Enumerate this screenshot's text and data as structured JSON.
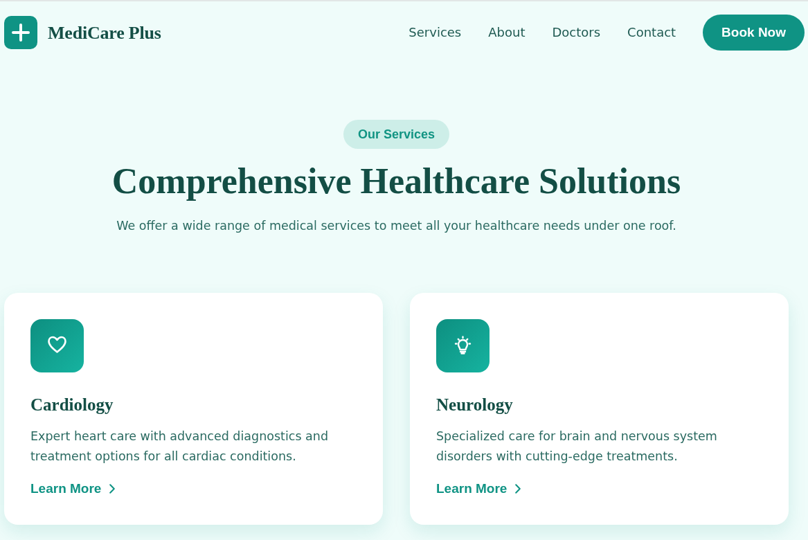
{
  "brand": {
    "name": "MediCare Plus"
  },
  "nav": {
    "links": [
      {
        "label": "Services"
      },
      {
        "label": "About"
      },
      {
        "label": "Doctors"
      },
      {
        "label": "Contact"
      }
    ],
    "cta": "Book Now"
  },
  "hero": {
    "badge": "Our Services",
    "title": "Comprehensive Healthcare Solutions",
    "subtitle": "We offer a wide range of medical services to meet all your healthcare needs under one roof."
  },
  "services": [
    {
      "title": "Cardiology",
      "description": "Expert heart care with advanced diagnostics and treatment options for all cardiac conditions.",
      "link": "Learn More"
    },
    {
      "title": "Neurology",
      "description": "Specialized care for brain and nervous system disorders with cutting-edge treatments.",
      "link": "Learn More"
    }
  ]
}
